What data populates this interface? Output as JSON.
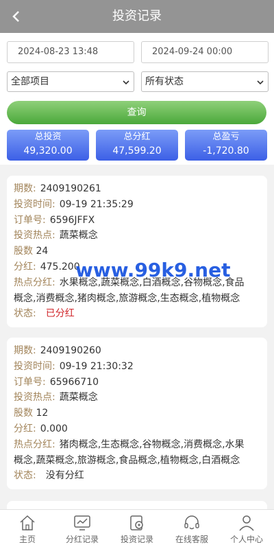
{
  "header": {
    "title": "投资记录"
  },
  "filters": {
    "start_date": "2024-08-23 13:48",
    "end_date": "2024-09-24 00:00",
    "project_select": "全部项目",
    "status_select": "所有状态",
    "query_label": "查询"
  },
  "stats": [
    {
      "label": "总投资",
      "value": "49,320.00"
    },
    {
      "label": "总分红",
      "value": "47,599.20"
    },
    {
      "label": "总盈亏",
      "value": "-1,720.80"
    }
  ],
  "labels": {
    "period": "期数:",
    "time": "投资时间:",
    "order": "订单号:",
    "hot": "投资热点:",
    "shares": "股数",
    "dividend": "分红:",
    "hot_dividend": "热点分红:",
    "status": "状态:"
  },
  "records": [
    {
      "period": "2409190261",
      "time": "09-19 21:35:29",
      "order": "6596JFFX",
      "hot": "蔬菜概念",
      "shares": "24",
      "dividend": "475.200",
      "hot_dividend_line1": "水果概念,蔬菜概念,白酒概念,谷物概念,食品",
      "hot_dividend_line2": "概念,消费概念,猪肉概念,旅游概念,生态概念,植物概念",
      "status": "已分红"
    },
    {
      "period": "2409190260",
      "time": "09-19 21:30:32",
      "order": "65966710",
      "hot": "蔬菜概念",
      "shares": "12",
      "dividend": "0.000",
      "hot_dividend_line1": "猪肉概念,生态概念,谷物概念,消费概念,水果",
      "hot_dividend_line2": "概念,蔬菜概念,旅游概念,食品概念,植物概念,白酒概念",
      "status": "没有分红"
    }
  ],
  "watermark": "www.99k9.net",
  "tabbar": [
    {
      "label": "主页",
      "icon": "home-icon"
    },
    {
      "label": "分红记录",
      "icon": "chart-icon"
    },
    {
      "label": "投资记录",
      "icon": "invest-icon"
    },
    {
      "label": "在线客服",
      "icon": "headset-icon"
    },
    {
      "label": "个人中心",
      "icon": "user-icon"
    }
  ]
}
